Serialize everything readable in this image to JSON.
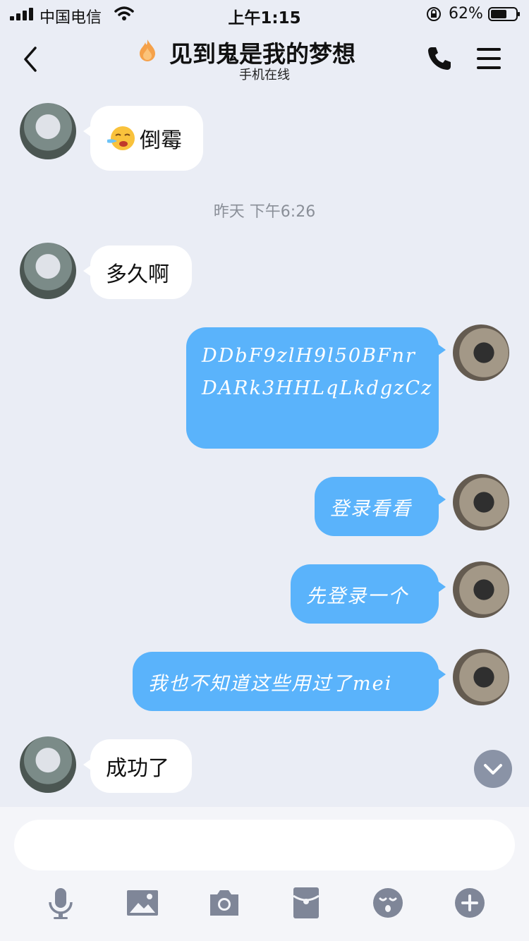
{
  "status": {
    "carrier": "中国电信",
    "time": "上午1:15",
    "battery": "62%"
  },
  "nav": {
    "title": "见到鬼是我的梦想",
    "subtitle": "手机在线"
  },
  "messages": {
    "m1": "倒霉",
    "time_divider": "昨天 下午6:26",
    "m2": "多久啊",
    "m3_line1": "DDbF9zlH9l50BFnr",
    "m3_line2": "DARk3HHLqLkdgzCz",
    "m4": "登录看看",
    "m5": "先登录一个",
    "m6": "我也不知道这些用过了mei",
    "m7": "成功了"
  },
  "composer": {
    "placeholder": ""
  },
  "icons": [
    "signal-icon",
    "wifi-icon",
    "orientation-lock-icon",
    "battery-icon",
    "back-icon",
    "flame-icon",
    "phone-icon",
    "menu-icon",
    "crying-emoji-icon",
    "chevron-down-icon",
    "microphone-icon",
    "image-icon",
    "camera-icon",
    "red-packet-icon",
    "emoji-icon",
    "plus-icon"
  ],
  "colors": {
    "background": "#eaedf5",
    "outgoing_bubble": "#5ab3fb",
    "incoming_bubble": "#ffffff",
    "toolbar_icon": "#7f8698"
  }
}
